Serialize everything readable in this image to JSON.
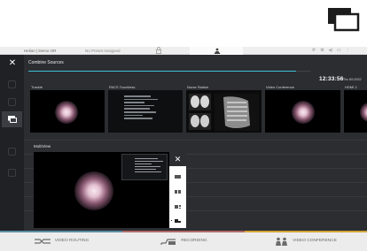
{
  "statusbar": {
    "room_label": "Helion | Demo OR",
    "preset_label": "No Preset Assigned",
    "icons": [
      "lock-icon",
      "person-icon",
      "phone-icon",
      "settings-icon",
      "volume-icon",
      "battery-icon",
      "menu-icon"
    ]
  },
  "panel": {
    "title": "Combine Sources",
    "progress": 0.95,
    "accent_color": "#3ec1d3"
  },
  "clock": {
    "time": "12:33:56",
    "date": "Thu 8/1/2022"
  },
  "sources": [
    {
      "label": "Trackie"
    },
    {
      "label": "PACS Touchless"
    },
    {
      "label": "Nurse Station"
    },
    {
      "label": "Video Conference"
    },
    {
      "label": "HDMI 2"
    }
  ],
  "multiview": {
    "label": "MultiView",
    "layout_buttons": [
      "close-icon",
      "layout-single-icon",
      "layout-double-icon",
      "layout-triple-icon",
      "layout-pip-icon"
    ]
  },
  "bottom_nav": [
    {
      "label": "VIDEO ROUTING",
      "icon": "routing-icon",
      "color": "#5b8fa3"
    },
    {
      "label": "RECORDING",
      "icon": "recording-icon",
      "color": "#b06a6a"
    },
    {
      "label": "VIDEO CONFERENCE",
      "icon": "conference-icon",
      "color": "#d3a43a"
    }
  ]
}
